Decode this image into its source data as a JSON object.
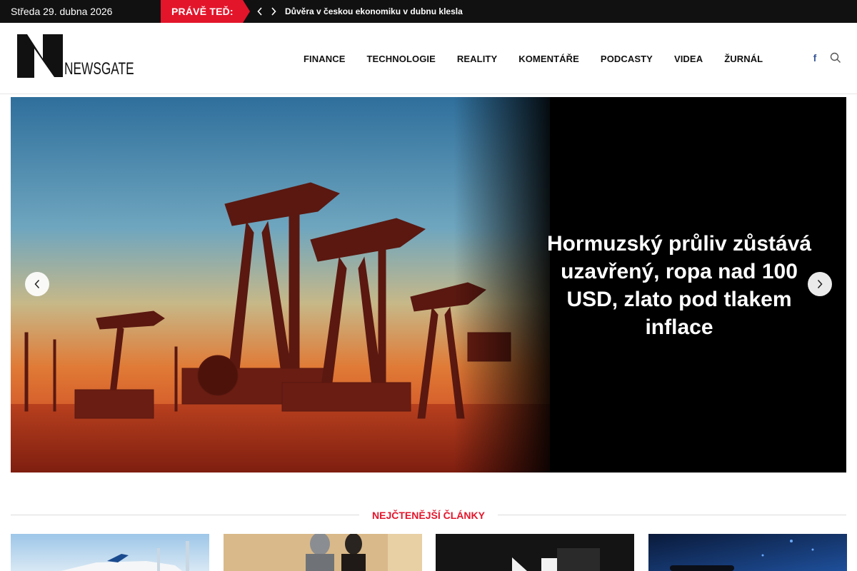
{
  "topbar": {
    "date": "Středa 29. dubna 2026",
    "now_label": "PRÁVĚ TEĎ:",
    "ticker_headline": "Důvěra v českou ekonomiku v dubnu klesla"
  },
  "header": {
    "logo_text": "NEWSGATE",
    "nav": [
      "FINANCE",
      "TECHNOLOGIE",
      "REALITY",
      "KOMENTÁŘE",
      "PODCASTY",
      "VIDEA",
      "ŽURNÁL"
    ],
    "social_icon": "facebook-icon",
    "search_icon": "search-icon"
  },
  "hero": {
    "headline": "Hormuzský průliv zůstává uzavřený, ropa nad 100 USD, zlato pod tlakem inflace",
    "image_subject": "oil pumpjacks at sunset"
  },
  "section": {
    "title": "NEJČTENĚJŠÍ ČLÁNKY"
  },
  "cards": [
    {
      "image_subject": "airliner on runway"
    },
    {
      "image_subject": "robot and woman silhouette"
    },
    {
      "image_subject": "play button video thumbnail"
    },
    {
      "image_subject": "phone on blue digital background"
    }
  ],
  "colors": {
    "accent": "#e3152b",
    "topbar_bg": "#111111",
    "facebook": "#3b5998"
  }
}
